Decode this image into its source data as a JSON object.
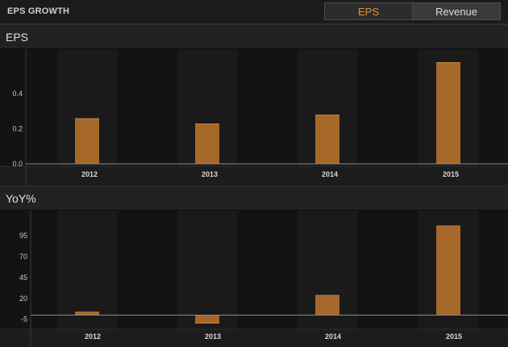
{
  "header": {
    "title": "EPS GROWTH"
  },
  "toggle": {
    "eps_label": "EPS",
    "revenue_label": "Revenue"
  },
  "sections": {
    "eps_title": "EPS",
    "yoy_title": "YoY%"
  },
  "colors": {
    "bar": "#a5672a",
    "bar_edge": "#c7843c",
    "active_text": "#e8913a"
  },
  "chart_data": [
    {
      "type": "bar",
      "categories": [
        "2012",
        "2013",
        "2014",
        "2015"
      ],
      "values": [
        0.26,
        0.23,
        0.28,
        0.58
      ],
      "yticks": [
        "0.0",
        "0.2",
        "0.4"
      ],
      "ytick_values": [
        0.0,
        0.2,
        0.4
      ],
      "ylim": [
        0,
        0.64
      ],
      "title": "EPS"
    },
    {
      "type": "bar",
      "categories": [
        "2012",
        "2013",
        "2014",
        "2015"
      ],
      "values": [
        4,
        -10,
        24,
        107
      ],
      "yticks": [
        "-5",
        "20",
        "45",
        "70",
        "95"
      ],
      "ytick_values": [
        -5,
        20,
        45,
        70,
        95
      ],
      "ylim": [
        -14,
        122
      ],
      "title": "YoY%"
    }
  ]
}
